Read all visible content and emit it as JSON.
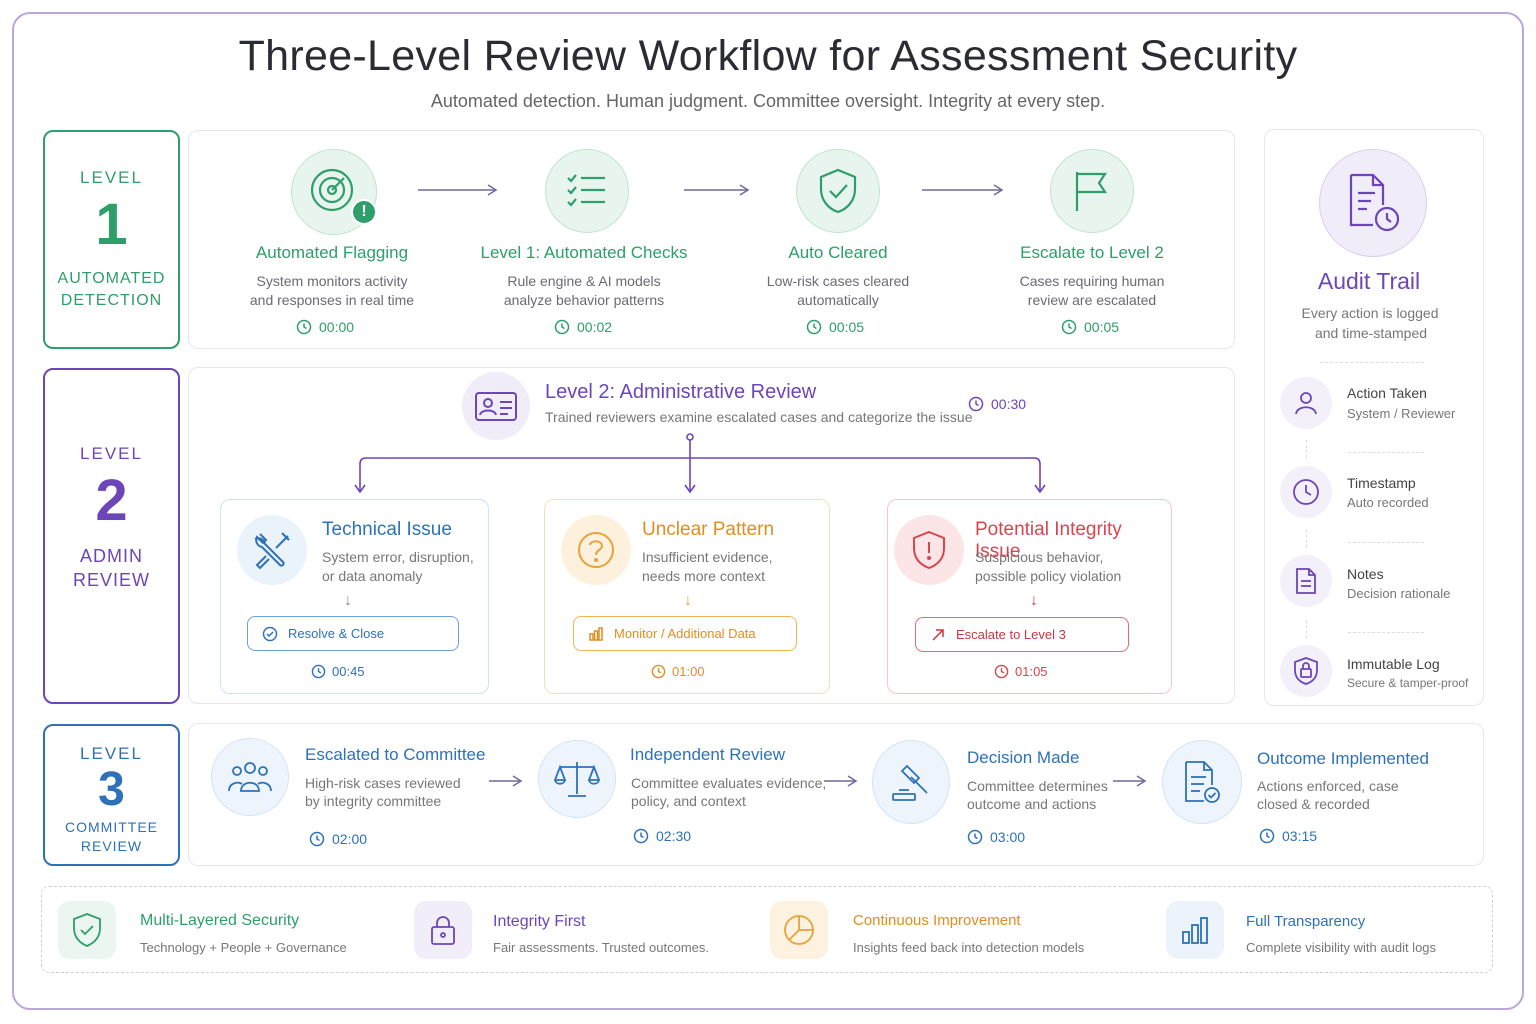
{
  "title": "Three-Level Review Workflow for Assessment Security",
  "subtitle": "Automated detection. Human judgment. Committee oversight. Integrity at every step.",
  "colors": {
    "green": "#2e9e6a",
    "purple": "#6c45b8",
    "blue": "#2d72b8",
    "orange": "#e8a23a",
    "red": "#d8454f"
  },
  "level1": {
    "tab": {
      "label": "LEVEL",
      "number": "1",
      "desc_line1": "AUTOMATED",
      "desc_line2": "DETECTION"
    },
    "steps": [
      {
        "icon": "radar-alert-icon",
        "title": "Automated Flagging",
        "desc_line1": "System monitors activity",
        "desc_line2": "and responses in real time",
        "time": "00:00"
      },
      {
        "icon": "checklist-icon",
        "title": "Level 1: Automated Checks",
        "desc_line1": "Rule engine & AI models",
        "desc_line2": "analyze behavior patterns",
        "time": "00:02"
      },
      {
        "icon": "shield-check-icon",
        "title": "Auto Cleared",
        "desc_line1": "Low-risk cases cleared",
        "desc_line2": "automatically",
        "time": "00:05"
      },
      {
        "icon": "flag-icon",
        "title": "Escalate to Level 2",
        "desc_line1": "Cases requiring human",
        "desc_line2": "review are escalated",
        "time": "00:05"
      }
    ]
  },
  "level2": {
    "tab": {
      "label": "LEVEL",
      "number": "2",
      "desc_line1": "ADMIN",
      "desc_line2": "REVIEW"
    },
    "header": {
      "icon": "id-card-icon",
      "title": "Level 2: Administrative Review",
      "desc": "Trained reviewers examine escalated cases and categorize the issue",
      "time": "00:30"
    },
    "categories": [
      {
        "icon": "tools-icon",
        "title": "Technical Issue",
        "desc_line1": "System error, disruption,",
        "desc_line2": "or data anomaly",
        "action_icon": "check-circle-icon",
        "action": "Resolve & Close",
        "time": "00:45"
      },
      {
        "icon": "question-icon",
        "title": "Unclear Pattern",
        "desc_line1": "Insufficient evidence,",
        "desc_line2": "needs more context",
        "action_icon": "bar-chart-icon",
        "action": "Monitor / Additional Data",
        "time": "01:00"
      },
      {
        "icon": "shield-alert-icon",
        "title": "Potential Integrity Issue",
        "desc_line1": "Suspicious behavior,",
        "desc_line2": "possible policy violation",
        "action_icon": "arrow-up-right-icon",
        "action": "Escalate to Level 3",
        "time": "01:05"
      }
    ]
  },
  "level3": {
    "tab": {
      "label": "LEVEL",
      "number": "3",
      "desc_line1": "COMMITTEE",
      "desc_line2": "REVIEW"
    },
    "steps": [
      {
        "icon": "people-icon",
        "title": "Escalated to Committee",
        "desc_line1": "High-risk cases reviewed",
        "desc_line2": "by integrity committee",
        "time": "02:00"
      },
      {
        "icon": "scales-icon",
        "title": "Independent Review",
        "desc_line1": "Committee evaluates evidence,",
        "desc_line2": "policy, and context",
        "time": "02:30"
      },
      {
        "icon": "gavel-icon",
        "title": "Decision Made",
        "desc_line1": "Committee determines",
        "desc_line2": "outcome and actions",
        "time": "03:00"
      },
      {
        "icon": "document-check-icon",
        "title": "Outcome Implemented",
        "desc_line1": "Actions enforced, case",
        "desc_line2": "closed & recorded",
        "time": "03:15"
      }
    ]
  },
  "audit": {
    "icon": "document-clock-icon",
    "title": "Audit Trail",
    "desc_line1": "Every action is logged",
    "desc_line2": "and time-stamped",
    "items": [
      {
        "icon": "user-icon",
        "title": "Action Taken",
        "sub": "System / Reviewer"
      },
      {
        "icon": "clock-icon",
        "title": "Timestamp",
        "sub": "Auto recorded"
      },
      {
        "icon": "note-icon",
        "title": "Notes",
        "sub": "Decision rationale"
      },
      {
        "icon": "lock-shield-icon",
        "title": "Immutable Log",
        "sub": "Secure & tamper-proof"
      }
    ]
  },
  "footer": [
    {
      "icon": "shield-check-icon",
      "title": "Multi-Layered Security",
      "sub": "Technology + People + Governance"
    },
    {
      "icon": "lock-icon",
      "title": "Integrity First",
      "sub": "Fair assessments. Trusted outcomes."
    },
    {
      "icon": "pie-chart-icon",
      "title": "Continuous Improvement",
      "sub": "Insights feed back into detection models"
    },
    {
      "icon": "bar-chart-icon",
      "title": "Full Transparency",
      "sub": "Complete visibility with audit logs"
    }
  ]
}
